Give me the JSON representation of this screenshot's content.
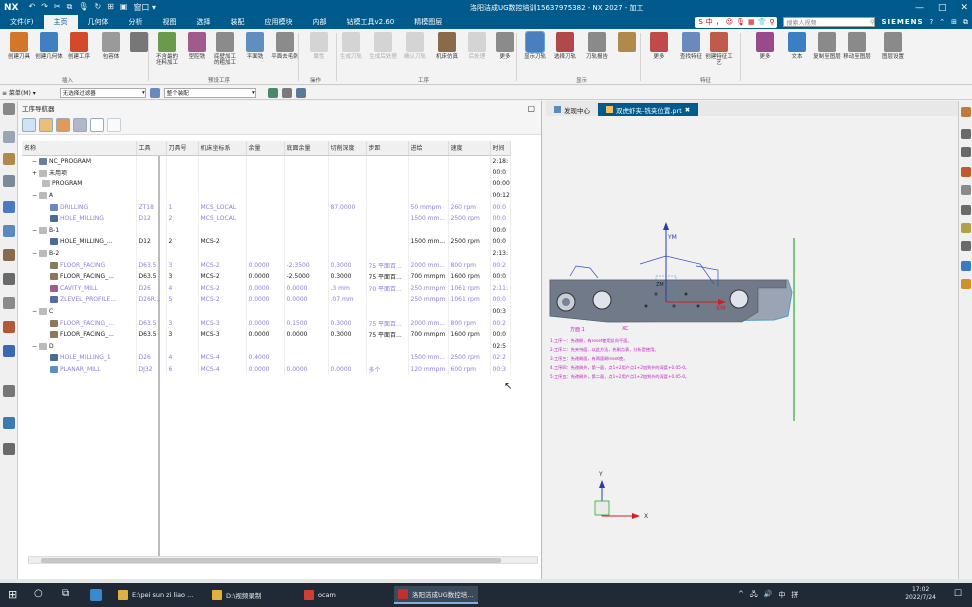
{
  "window": {
    "logo": "NX",
    "title": "洛阳洁成UG数控培训15637975382 - NX 2027 - 加工",
    "qat": [
      "↶",
      "↷",
      "✂",
      "⧉",
      "🎙",
      "↻",
      "⊞",
      "▣",
      "窗口 ▾"
    ],
    "brand": "SIEMENS",
    "search_placeholder": "搜索人视频"
  },
  "menu": {
    "tabs": [
      "文件(F)",
      "主页",
      "几何体",
      "分析",
      "视图",
      "选择",
      "装配",
      "应用模块",
      "内部",
      "钻模工具v2.60",
      "精模图层"
    ],
    "active": "主页",
    "ime": [
      "S",
      "中",
      "，",
      "☺",
      "🎙",
      "▦",
      "👕",
      "⚲"
    ]
  },
  "ribbon": {
    "buttons": [
      {
        "label": "创建刀具",
        "color": "#d2762a",
        "dim": false,
        "sel": false
      },
      {
        "label": "创建几何体",
        "color": "#3f7fc2",
        "dim": false,
        "sel": false
      },
      {
        "label": "创建工序",
        "color": "#d24a2a",
        "dim": false,
        "sel": false
      },
      {
        "label": "包容体",
        "color": "#9a9a9a",
        "dim": false,
        "sel": false
      },
      {
        "label": "",
        "color": "#777777",
        "dim": false,
        "sel": false
      },
      {
        "label": "不含最的\n坯料加工",
        "color": "#6b9a4a",
        "dim": false,
        "sel": false
      },
      {
        "label": "型腔铣",
        "color": "#a05a8c",
        "dim": false,
        "sel": false
      },
      {
        "label": "底壁加工\n的粗加工",
        "color": "#8b8b8b",
        "dim": false,
        "sel": false
      },
      {
        "label": "平面铣",
        "color": "#5f8fbf",
        "dim": false,
        "sel": false
      },
      {
        "label": "平面去毛刺",
        "color": "#8b8b8b",
        "dim": false,
        "sel": false
      },
      {
        "label": "属性",
        "color": "#9a9a9a",
        "dim": true,
        "sel": false
      },
      {
        "label": "生成刀轨",
        "color": "#9a9a9a",
        "dim": true,
        "sel": false
      },
      {
        "label": "生成后处理",
        "color": "#9a9a9a",
        "dim": true,
        "sel": false
      },
      {
        "label": "确认刀轨",
        "color": "#9a9a9a",
        "dim": true,
        "sel": false
      },
      {
        "label": "机床仿真",
        "color": "#8b6a4a",
        "dim": false,
        "sel": false
      },
      {
        "label": "后处理",
        "color": "#9a9a9a",
        "dim": true,
        "sel": false
      },
      {
        "label": "更多",
        "color": "#8b8b8b",
        "dim": false,
        "sel": false
      },
      {
        "label": "显示刀轨",
        "color": "#4a7fbf",
        "dim": false,
        "sel": true
      },
      {
        "label": "选择刀轨",
        "color": "#b04a4a",
        "dim": false,
        "sel": false
      },
      {
        "label": "刀轨报告",
        "color": "#8a8a8a",
        "dim": false,
        "sel": false
      },
      {
        "label": "",
        "color": "#b08a4a",
        "dim": false,
        "sel": false
      },
      {
        "label": "更多",
        "color": "#c04a4a",
        "dim": false,
        "sel": false
      },
      {
        "label": "查找特征",
        "color": "#6a8abf",
        "dim": false,
        "sel": false
      },
      {
        "label": "创建特征工艺",
        "color": "#c05a4a",
        "dim": false,
        "sel": false
      },
      {
        "label": "更多",
        "color": "#9a4a8a",
        "dim": false,
        "sel": false
      },
      {
        "label": "文本",
        "color": "#3a7fc2",
        "dim": false,
        "sel": false
      },
      {
        "label": "复制至图层",
        "color": "#8a8a8a",
        "dim": false,
        "sel": false
      },
      {
        "label": "移动至图层",
        "color": "#8a8a8a",
        "dim": false,
        "sel": false
      },
      {
        "label": "图层设置",
        "color": "#8a8a8a",
        "dim": false,
        "sel": false
      }
    ],
    "groups": [
      "插入",
      "预设工序",
      "操作",
      "工序",
      "显示",
      "特征"
    ]
  },
  "filterbar": {
    "menu_label": "≡ 菜单(M) ▾",
    "filter": "无选择过滤器",
    "scope": "整个装配"
  },
  "navigator": {
    "title": "工序导航器",
    "columns": [
      "名称",
      "工具",
      "刀具号",
      "机床坐标系",
      "余量",
      "底面余量",
      "切削深度",
      "步距",
      "进给",
      "速度",
      "时间"
    ],
    "rows": [
      {
        "indent": 1,
        "exp": "−",
        "icon": "#6b7fa0",
        "name": "NC_PROGRAM",
        "dim": false,
        "cells": [
          "",
          "",
          "",
          "",
          "",
          "",
          "",
          "",
          "",
          "2:18:"
        ]
      },
      {
        "indent": 1,
        "exp": "+",
        "icon": "#bbbbbb",
        "name": "未用项",
        "dim": false,
        "cells": [
          "",
          "",
          "",
          "",
          "",
          "",
          "",
          "",
          "",
          "00:0"
        ]
      },
      {
        "indent": 2,
        "exp": "",
        "icon": "#bbbbbb",
        "name": "PROGRAM",
        "dim": false,
        "cells": [
          "",
          "",
          "",
          "",
          "",
          "",
          "",
          "",
          "",
          "00:00"
        ]
      },
      {
        "indent": 1,
        "exp": "−",
        "icon": "#bbbbbb",
        "name": "A",
        "dim": false,
        "cells": [
          "",
          "",
          "",
          "",
          "",
          "",
          "",
          "",
          "",
          "00:12:"
        ]
      },
      {
        "indent": 3,
        "exp": "",
        "icon": "#6a8abf",
        "name": "DRILLING",
        "dim": true,
        "cells": [
          "ZT18",
          "1",
          "MCS_LOCAL",
          "",
          "",
          "87.0000",
          "",
          "50 mmpm",
          "260 rpm",
          "00:0"
        ]
      },
      {
        "indent": 3,
        "exp": "",
        "icon": "#4a6a9a",
        "name": "HOLE_MILLING",
        "dim": true,
        "cells": [
          "D12",
          "2",
          "MCS_LOCAL",
          "",
          "",
          "",
          "",
          "1500 mm...",
          "2500 rpm",
          "00:0"
        ]
      },
      {
        "indent": 1,
        "exp": "−",
        "icon": "#bbbbbb",
        "name": "B-1",
        "dim": false,
        "cells": [
          "",
          "",
          "",
          "",
          "",
          "",
          "",
          "",
          "",
          "00:0"
        ]
      },
      {
        "indent": 3,
        "exp": "",
        "icon": "#4a6a9a",
        "name": "HOLE_MILLING_...",
        "dim": false,
        "cells": [
          "D12",
          "2",
          "MCS-2",
          "",
          "",
          "",
          "",
          "1500 mm...",
          "2500 rpm",
          "00:0"
        ]
      },
      {
        "indent": 1,
        "exp": "−",
        "icon": "#bbbbbb",
        "name": "B-2",
        "dim": false,
        "cells": [
          "",
          "",
          "",
          "",
          "",
          "",
          "",
          "",
          "",
          "2:13:"
        ]
      },
      {
        "indent": 3,
        "exp": "",
        "icon": "#8a7a5a",
        "name": "FLOOR_FACING",
        "dim": true,
        "cells": [
          "D63.5",
          "3",
          "MCS-2",
          "0.0000",
          "-2.3500",
          "0.3000",
          "75 平面百...",
          "2000 mm...",
          "800 rpm",
          "00:2"
        ]
      },
      {
        "indent": 3,
        "exp": "",
        "icon": "#8a7a5a",
        "name": "FLOOR_FACING_...",
        "dim": false,
        "cells": [
          "D63.5",
          "3",
          "MCS-2",
          "0.0000",
          "-2.5000",
          "0.3000",
          "75 平面百...",
          "700 mmpm",
          "1600 rpm",
          "00:0"
        ]
      },
      {
        "indent": 3,
        "exp": "",
        "icon": "#a05a8c",
        "name": "CAVITY_MILL",
        "dim": true,
        "cells": [
          "D26",
          "4",
          "MCS-2",
          "0.0000",
          "0.0000",
          ".3 mm",
          "70 平面百...",
          "250 mmpm",
          "1061 rpm",
          "2:11:"
        ]
      },
      {
        "indent": 3,
        "exp": "",
        "icon": "#5a6aa0",
        "name": "ZLEVEL_PROFILE...",
        "dim": true,
        "cells": [
          "D26R...",
          "5",
          "MCS-2",
          "0.0000",
          "0.0000",
          ".07 mm",
          "",
          "250 mmpm",
          "1061 rpm",
          "00:0"
        ]
      },
      {
        "indent": 1,
        "exp": "−",
        "icon": "#bbbbbb",
        "name": "C",
        "dim": false,
        "cells": [
          "",
          "",
          "",
          "",
          "",
          "",
          "",
          "",
          "",
          "00:3"
        ]
      },
      {
        "indent": 3,
        "exp": "",
        "icon": "#8a7a5a",
        "name": "FLOOR_FACING_...",
        "dim": true,
        "cells": [
          "D63.5",
          "3",
          "MCS-3",
          "0.0000",
          "0.1500",
          "0.3000",
          "75 平面百...",
          "2000 mm...",
          "800 rpm",
          "00:2"
        ]
      },
      {
        "indent": 3,
        "exp": "",
        "icon": "#8a7a5a",
        "name": "FLOOR_FACING_...",
        "dim": false,
        "cells": [
          "D63.5",
          "3",
          "MCS-3",
          "0.0000",
          "0.0000",
          "0.3000",
          "75 平面百...",
          "700 mmpm",
          "1600 rpm",
          "00:0"
        ]
      },
      {
        "indent": 1,
        "exp": "−",
        "icon": "#bbbbbb",
        "name": "D",
        "dim": false,
        "cells": [
          "",
          "",
          "",
          "",
          "",
          "",
          "",
          "",
          "",
          "02:5"
        ]
      },
      {
        "indent": 3,
        "exp": "",
        "icon": "#4a6a9a",
        "name": "HOLE_MILLING_1",
        "dim": true,
        "cells": [
          "D26",
          "4",
          "MCS-4",
          "0.4000",
          "",
          "",
          "",
          "1500 mm...",
          "2500 rpm",
          "02:2"
        ]
      },
      {
        "indent": 3,
        "exp": "",
        "icon": "#5f8fbf",
        "name": "PLANAR_MILL",
        "dim": true,
        "cells": [
          "DJ32",
          "6",
          "MCS-4",
          "0.0000",
          "0.0000",
          "0.0000",
          "多个",
          "120 mmpm",
          "600 rpm",
          "00:3"
        ]
      }
    ]
  },
  "graphics": {
    "tabs": [
      {
        "label": "发现中心",
        "active": false
      },
      {
        "label": "双虎虾夹-铣夹位置.prt",
        "active": true
      }
    ],
    "close_glyph": "✖",
    "axis_ym": "YM",
    "axis_xm": "XM",
    "csys_label": "ZM",
    "triad_y": "Y",
    "triad_x": "X",
    "annotation_title": "方面 1",
    "annotation_lines": [
      "1.工序一：先改刷，有reset使用反向平面。",
      "2.工序二：先夹持面...以此方法，先刷点表，分析是使用。",
      "3.工序三：先改刷面，有两面刷reset使。",
      "4.工序四：先改刷外，第一面，点1+2用户点1+2加到外的深度+0.05-0。",
      "5.工序五：先改刷外，第二面，点1+2用户点1+2加到外的深度+0.05-0。"
    ]
  },
  "taskbar": {
    "apps": [
      {
        "label": "E:\\pei sun zi liao ...",
        "color": "#e0b040"
      },
      {
        "label": "D:\\视频录制",
        "color": "#e0b040"
      },
      {
        "label": "ocam",
        "color": "#d04030"
      },
      {
        "label": "洛阳洁成UG数控培...",
        "color": "#c03030"
      }
    ],
    "time": "17:02",
    "date": "2022/7/24",
    "tray": [
      "^",
      "🖧",
      "🔊",
      "中",
      "拼"
    ]
  }
}
